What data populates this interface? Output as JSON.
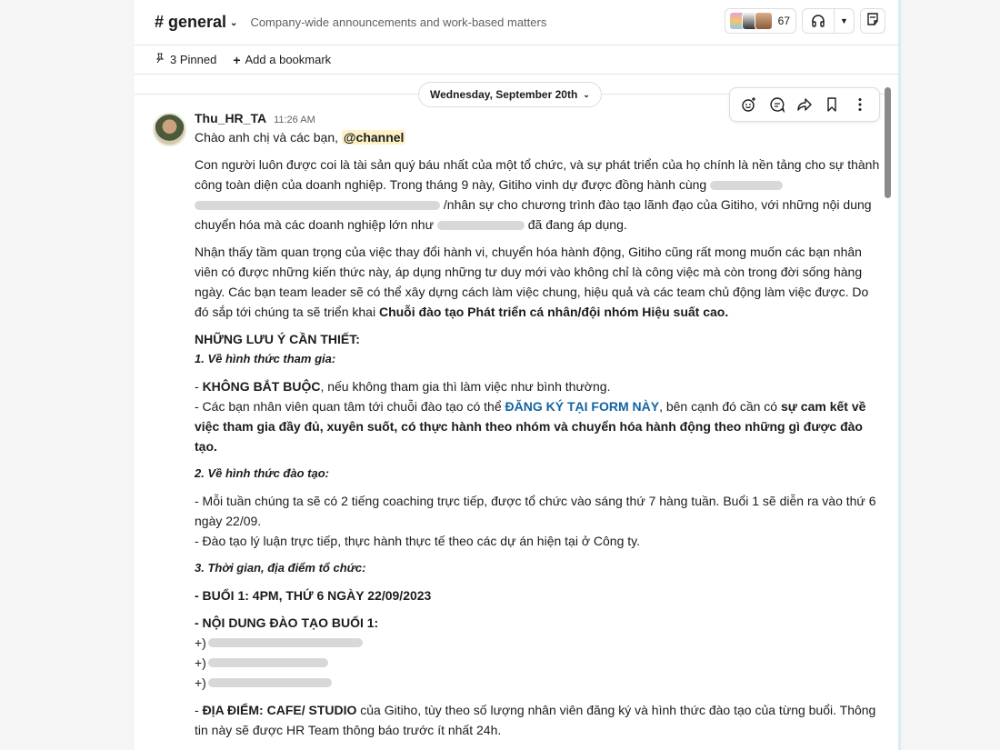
{
  "header": {
    "channel": "# general",
    "topic": "Company-wide announcements and work-based matters",
    "member_count": "67"
  },
  "bookmarks": {
    "pinned": "3 Pinned",
    "add": "Add a bookmark"
  },
  "date_divider": "Wednesday, September 20th",
  "message": {
    "author": "Thu_HR_TA",
    "time": "11:26 AM",
    "greeting": "Chào anh chị và các bạn,",
    "mention": "@channel",
    "p1a": "Con người luôn được coi là tài sản quý báu nhất của một tổ chức, và sự phát triển của họ chính là nền tảng cho sự thành công toàn diện của doanh nghiệp. Trong tháng 9 này, Gitiho vinh dự được đồng hành cùng",
    "p1b": "/nhân sự cho chương trình đào tạo lãnh đạo của Gitiho, với những nội dung chuyển hóa mà các doanh nghiệp lớn như",
    "p1c": "đã đang áp dụng.",
    "p2": "Nhận thấy tầm quan trọng của việc thay đổi hành vi, chuyển hóa hành động, Gitiho cũng rất mong muốn các bạn nhân viên có được những kiến thức này, áp dụng những tư duy mới vào không chỉ là công việc mà còn trong đời sống hàng ngày. Các bạn team leader sẽ có thể xây dựng cách làm việc chung, hiệu quả và các team chủ động làm việc được. Do đó sắp tới chúng ta sẽ triển khai",
    "p2_bold": "Chuỗi đào tạo Phát triển cá nhân/đội nhóm Hiệu suất cao.",
    "notes_title": "NHỮNG LƯU Ý CẦN THIẾT:",
    "s1_title": "1. Về hình thức tham gia:",
    "s1_l1_bold": "KHÔNG BẮT BUỘC",
    "s1_l1_rest": ", nếu không tham gia thì làm việc như bình thường.",
    "s1_l2_a": "- Các bạn nhân viên quan tâm tới chuỗi đào tạo có thể",
    "s1_l2_link": "ĐĂNG KÝ TẠI FORM NÀY",
    "s1_l2_b": ", bên cạnh đó cần có",
    "s1_l2_bold": "sự cam kết về việc tham gia đầy đủ, xuyên suốt, có thực hành theo nhóm và chuyển hóa hành động theo những gì được đào tạo.",
    "s2_title": "2. Về hình thức đào tạo:",
    "s2_l1": "- Mỗi tuần chúng ta sẽ có 2 tiếng coaching trực tiếp, được tổ chức vào sáng thứ 7 hàng tuần. Buổi 1 sẽ diễn ra vào thứ 6 ngày 22/09.",
    "s2_l2": "- Đào tạo lý luận trực tiếp, thực hành thực tế theo các dự án hiện tại ở Công ty.",
    "s3_title": "3. Thời gian, địa điểm tổ chức:",
    "s3_l1": "- BUỔI 1: 4PM, THỨ 6 NGÀY 22/09/2023",
    "s3_l2": "- NỘI DUNG ĐÀO TẠO BUỔI 1:",
    "bullet": "+)",
    "loc_bold": "ĐỊA ĐIỂM: CAFE/ STUDIO",
    "loc_rest": "của Gitiho, tùy theo số lượng nhân viên đăng ký và hình thức đào tạo của từng buổi. Thông tin này sẽ được HR Team thông báo trước ít nhất 24h."
  },
  "colors": {
    "link": "#1264a3",
    "mention_bg": "#fdf2c6"
  },
  "icons": [
    "chevron-down-icon",
    "headphones-icon",
    "canvas-icon",
    "pin-icon",
    "plus-icon",
    "add-reaction-icon",
    "reply-thread-icon",
    "forward-icon",
    "bookmark-icon",
    "more-icon"
  ]
}
